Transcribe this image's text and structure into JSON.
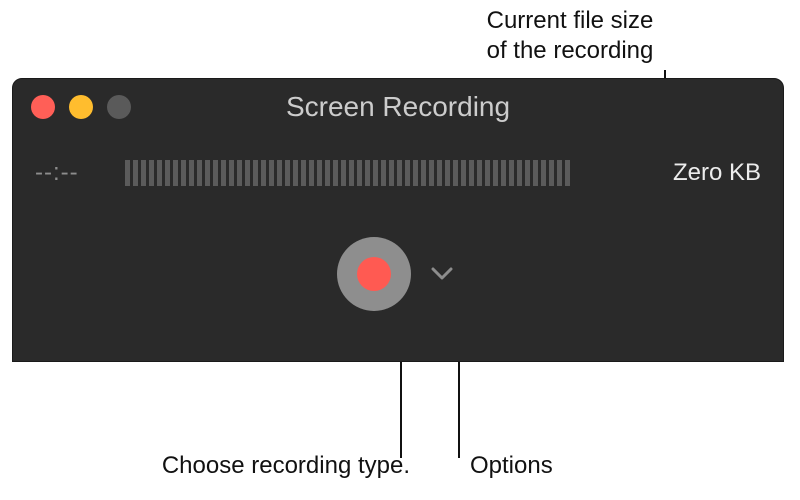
{
  "window": {
    "title": "Screen Recording",
    "timer": "--:--",
    "filesize": "Zero KB",
    "meter_segments": 56
  },
  "callouts": {
    "filesize_line1": "Current file size",
    "filesize_line2": "of the recording",
    "record": "Choose recording type.",
    "options": "Options"
  }
}
